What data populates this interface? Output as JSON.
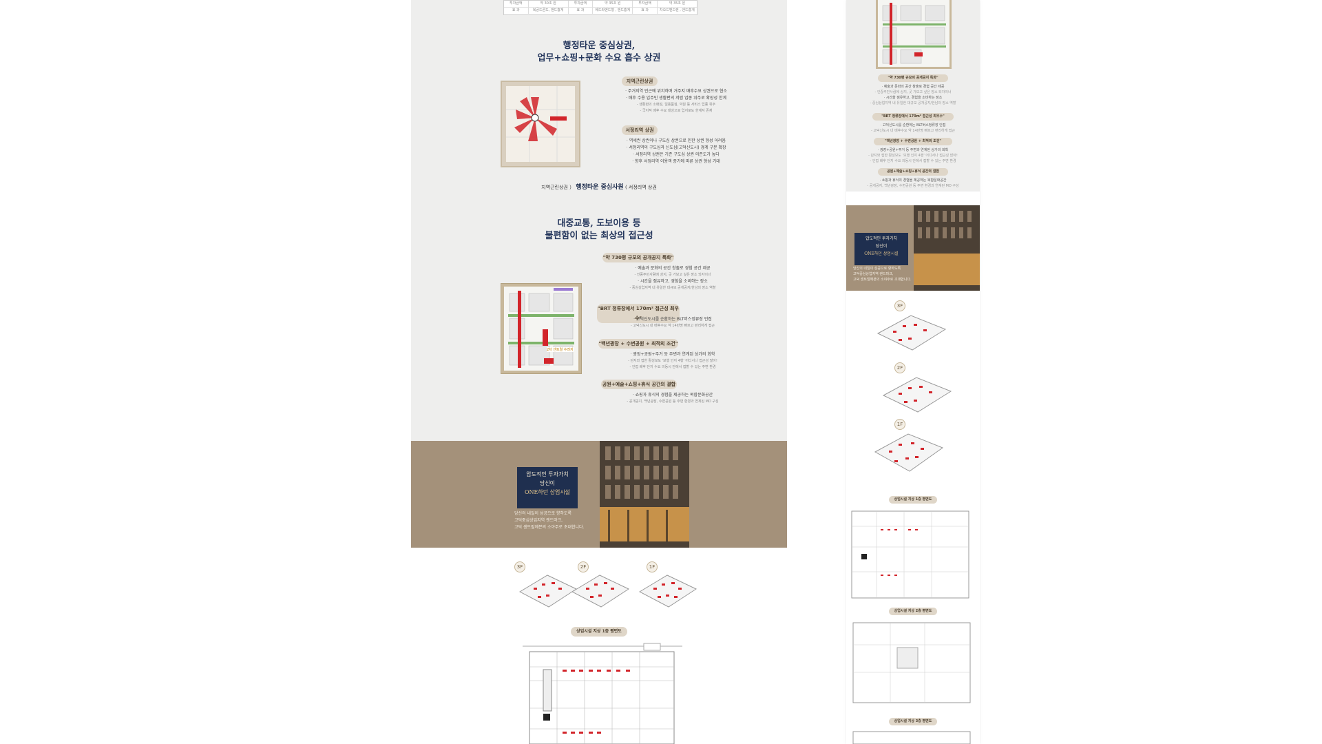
{
  "left": {
    "table": {
      "rows": [
        [
          "투자금액",
          "약 30조 원",
          "투자금액",
          "약 35조 원",
          "투자금액",
          "약 35조 원"
        ],
        [
          "효 과",
          "복궁드론도, 앤드흥게",
          "효 과",
          "에드라벤드형 , 앤드흥게",
          "효 과",
          "차오드벤드랜 , 앤드흥게"
        ]
      ]
    },
    "section1": {
      "title_line1": "행정타운 중심상권,",
      "title_line2": "업무+쇼핑+문화 수요 흡수 상권",
      "pill1": "지역근린상권",
      "bullets1": [
        "· 주거지역 인근에 위치하며 거주지 배후수요 상권으로 협소",
        "· 배후 수용 입주민 생활편의 저렴 업종 위주로 확장성 한계"
      ],
      "sub1": [
        "- 생활편의 소매점, 일용품점, 약원 등 서비스 업종 위주",
        "- 국지적 배후 수요 대상으로 입지로도 한계지 존재"
      ],
      "pill2": "서정리역 상권",
      "bullets2": [
        "· 역세권 상권이나 구도심 상권으로 인한 상권 형성 어려움",
        "· 서정리역의 구도심과 신도심(고덕신도시) 경계 구분 확장",
        "· 서정리역 상권은 기존 구도심 상권 의존도가 높다",
        "· 향후 서정리역 이용객 증가에 따른 상권 형성 기대"
      ],
      "caption_a": "지역근린상권 ）",
      "caption_b": "행정타운 중심사원",
      "caption_c": "( 서정리역 상권"
    },
    "section2": {
      "title_line1": "대중교통, 도보이용 등",
      "title_line2": "불편함이 없는 최상의 접근성",
      "pill1": "\"약 730평 규모의 공개공지 특화\"",
      "b1": [
        "· 예술과 문화의 공간 창출로 경험 공간 제공",
        "- 인증주민사람에 상지, 곳 가보고 싶은 장소 되자이너",
        "· 시간을 점유하고, 경험을 소비하는 장소",
        "- 중심상업지역 내 유일한 대규모 공개공지/한남의 장소 역할"
      ],
      "pill2": "\"BRT 정류장에서 170m² 접근성 최우수\"",
      "b2": [
        "· 고덕신도시를 순환하는 BLT버스정류장 인접",
        "- 고덕신도시 내 배후수요 약 14만명 빠르고 편리하게 접근"
      ],
      "pill3": "\"백년광장 + 수변공원 + 최적의 조건\"",
      "b3": [
        "· 광장+공원+주거 등 주변과 연계된 상가의 회학",
        "- 단지와 접한 활성보도 '보행 인지 4행' 어디서나 접근성 많아!",
        "- 인접 배후 단지 수요 의동시 안에서 접할 수 있는 주변 환경"
      ],
      "pill4": "공원+예술+쇼핑+휴식 공간의 결합",
      "b4": [
        "· 쇼핑과 휴식의 경험을 제공하는 복합문화공간",
        "- 공개공지, 백년광장, 수변공원 등 주변 환경과 연계된 MD 구성"
      ],
      "map_label": "2차 센트럴 수려지"
    },
    "banner": {
      "line1": "압도적인 투자가치",
      "line2": "당신이",
      "line3": "ONE하던 상업시설",
      "desc1": "당신의 내일이 성공으로 향하도록",
      "desc2": "고덕중심상업지역 랜드마크,",
      "desc3": "고덕 센트럴헤븐의 소야주로 초대합니다."
    },
    "floors": [
      "3F",
      "2F",
      "1F"
    ],
    "plan_title": "상업시설 지상 1층 평면도"
  },
  "right": {
    "pill1": "\"약 730평 규모의 공개공지 특화\"",
    "pill2": "\"BRT 정류장에서 170m² 접근성 최우수\"",
    "pill3": "\"백년광장 + 수변공원 + 최적의 조건\"",
    "pill4": "공원+예술+쇼핑+휴식 공간의 결합",
    "banner": {
      "line1": "압도적인 투자가치",
      "line2": "당신이",
      "line3": "ONE하던 상업시설",
      "desc1": "당신의 내일이 성공으로 향하도록",
      "desc2": "고덕중심상업지역 랜드마크,",
      "desc3": "고덕 센트럴헤븐의 소야주로 초대합니다."
    },
    "floors": [
      "3F",
      "2F",
      "1F"
    ],
    "plan_titles": [
      "상업시설 지상 1층 평면도",
      "상업시설 지상 2층 평면도",
      "상업시설 지상 3층 평면도"
    ]
  },
  "colors": {
    "navy": "#24365c",
    "beige": "#dfd6c8",
    "banner": "#a4917a",
    "panel": "#eeeeed"
  }
}
